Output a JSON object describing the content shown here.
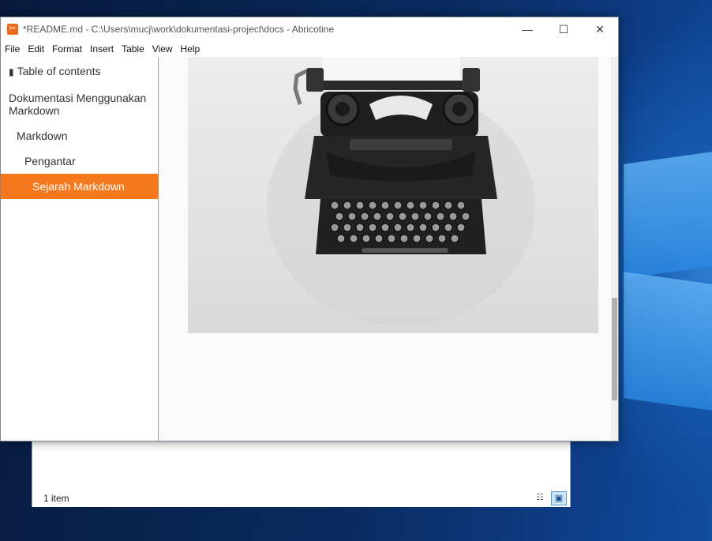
{
  "app": {
    "title": "*README.md - C:\\Users\\mucj\\work\\dokumentasi-project\\docs - Abricotine",
    "icon": "abricotine-icon",
    "accent": "#f5791c"
  },
  "menu": [
    "File",
    "Edit",
    "Format",
    "Insert",
    "Table",
    "View",
    "Help"
  ],
  "toc": {
    "heading": "Table of contents",
    "items": [
      {
        "label": "Dokumentasi Menggunakan Markdown",
        "level": 1
      },
      {
        "label": "Markdown",
        "level": 2
      },
      {
        "label": "Pengantar",
        "level": 3
      },
      {
        "label": "Sejarah Markdown",
        "level": 4,
        "active": true
      }
    ]
  },
  "content": {
    "image_subject": "typewriter"
  },
  "explorer": {
    "status": "1 item"
  }
}
